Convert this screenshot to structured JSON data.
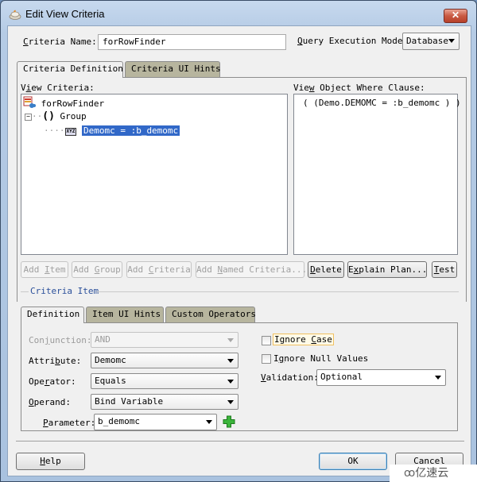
{
  "window": {
    "title": "Edit View Criteria",
    "close_label": "✕"
  },
  "criteria_name": {
    "label_pre": "",
    "label_mnemonic": "C",
    "label_post": "riteria Name:",
    "value": "forRowFinder"
  },
  "query_mode": {
    "label_mnemonic": "Q",
    "label_post": "uery Execution Mode:",
    "value": "Database"
  },
  "main_tabs": [
    {
      "label": "Criteria Definition",
      "active": true
    },
    {
      "label": "Criteria UI Hints",
      "active": false
    }
  ],
  "view_criteria": {
    "label_pre": "V",
    "label_mnemonic": "i",
    "label_post": "ew Criteria:",
    "tree": {
      "root": "forRowFinder",
      "group": "Group",
      "group_symbol": "()",
      "item_badge": "XYZ",
      "item": "Demomc = :b_demomc"
    }
  },
  "where_clause": {
    "label_pre": "Vie",
    "label_mnemonic": "w",
    "label_post": " Object Where Clause:",
    "text": "( (Demo.DEMOMC = :b_demomc ) )"
  },
  "action_buttons": [
    {
      "pre": "Add ",
      "m": "I",
      "post": "tem",
      "enabled": false
    },
    {
      "pre": "Add ",
      "m": "G",
      "post": "roup",
      "enabled": false
    },
    {
      "pre": "Add ",
      "m": "C",
      "post": "riteria",
      "enabled": false
    },
    {
      "pre": "Add ",
      "m": "N",
      "post": "amed Criteria...",
      "enabled": false
    },
    {
      "pre": "",
      "m": "D",
      "post": "elete",
      "enabled": true
    },
    {
      "pre": "E",
      "m": "x",
      "post": "plain Plan...",
      "enabled": true
    },
    {
      "pre": "",
      "m": "T",
      "post": "est",
      "enabled": true
    }
  ],
  "criteria_item": {
    "group_label": "Criteria Item",
    "tabs": [
      {
        "label": "Definition",
        "active": true
      },
      {
        "label": "Item UI Hints",
        "active": false
      },
      {
        "label": "Custom Operators",
        "active": false
      }
    ],
    "conjunction": {
      "label_pre": "Con",
      "label_mnemonic": "j",
      "label_post": "unction:",
      "value": "AND",
      "enabled": false
    },
    "attribute": {
      "label_pre": "Attri",
      "label_mnemonic": "b",
      "label_post": "ute:",
      "value": "Demomc"
    },
    "operator": {
      "label_pre": "Ope",
      "label_mnemonic": "r",
      "label_post": "ator:",
      "value": "Equals"
    },
    "operand": {
      "label_pre": "",
      "label_mnemonic": "O",
      "label_post": "perand:",
      "value": "Bind Variable"
    },
    "parameter": {
      "label_pre": "",
      "label_mnemonic": "P",
      "label_post": "arameter:",
      "value": "b_demomc"
    },
    "ignore_case": {
      "label_pre": "Ignore ",
      "label_mnemonic": "C",
      "label_post": "ase",
      "checked": false
    },
    "ignore_null": {
      "label_pre": "I",
      "label_mnemonic": "g",
      "label_post": "nore Null Values",
      "checked": false
    },
    "validation": {
      "label_pre": "",
      "label_mnemonic": "V",
      "label_post": "alidation:",
      "value": "Optional"
    }
  },
  "footer": {
    "help": {
      "m": "H",
      "post": "elp"
    },
    "ok": "OK",
    "cancel": "Cancel"
  },
  "watermark": "亿速云"
}
